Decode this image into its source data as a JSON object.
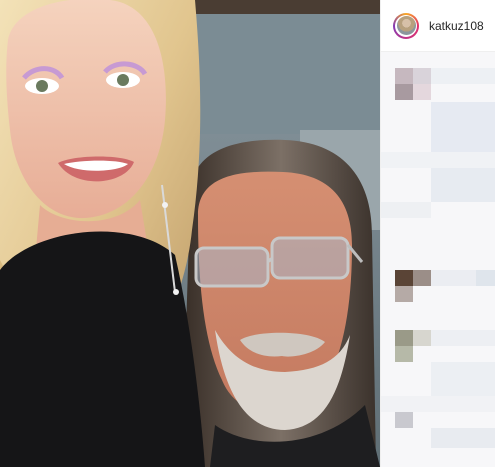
{
  "post": {
    "username": "katkuz108",
    "avatar_icon": "profile-avatar",
    "photo_description_icon": "selfie-photo",
    "comments_area": "pixelated-comments"
  },
  "colors": {
    "ring_start": "#f9a826",
    "ring_end": "#833ab4",
    "text": "#262626",
    "divider": "#efefef"
  }
}
